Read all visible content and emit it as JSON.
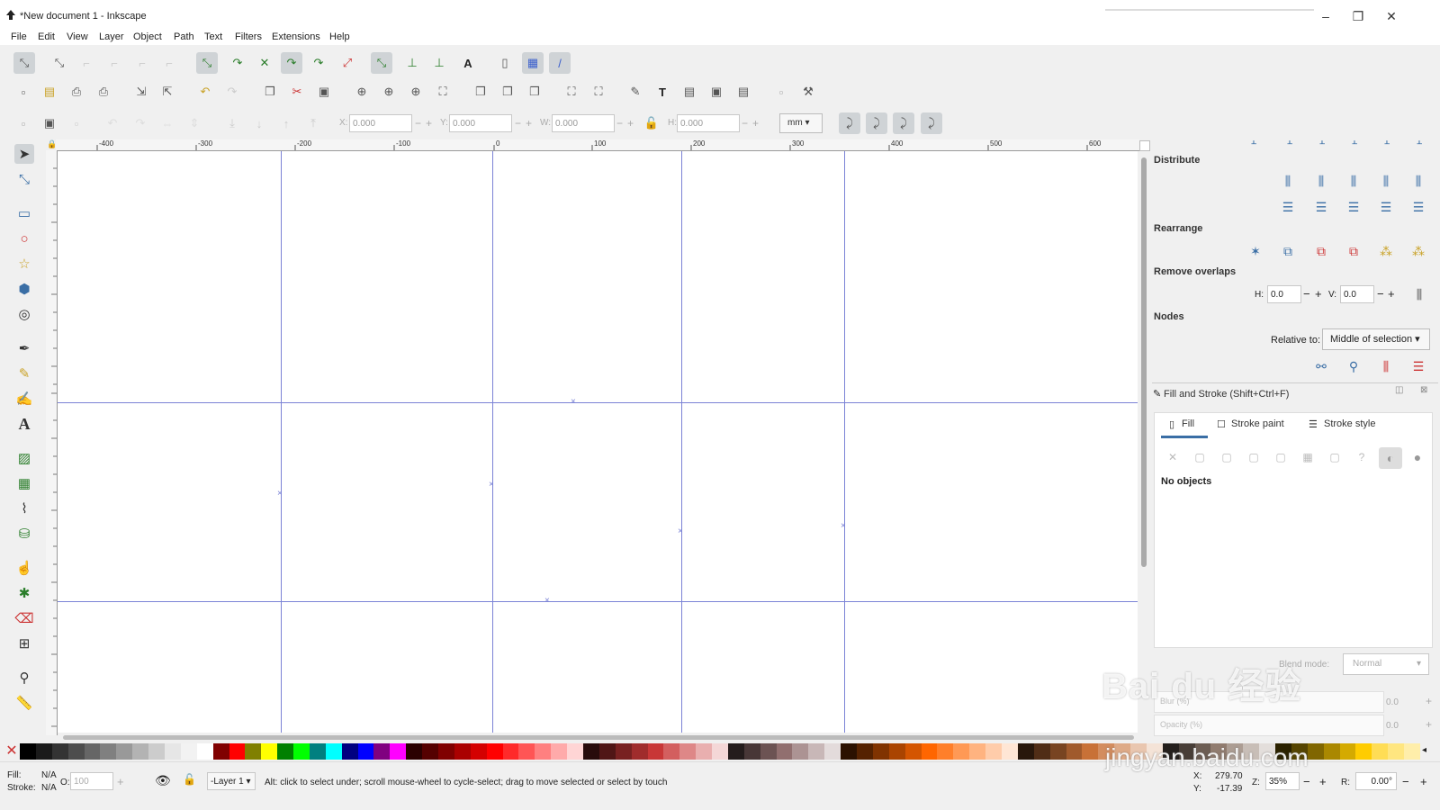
{
  "window": {
    "title": "*New document 1 - Inkscape",
    "minimize": "–",
    "maximize": "❐",
    "close": "✕"
  },
  "menu": [
    "File",
    "Edit",
    "View",
    "Layer",
    "Object",
    "Path",
    "Text",
    "Filters",
    "Extensions",
    "Help"
  ],
  "toolbar_select": {
    "x_label": "X:",
    "x_value": "0.000",
    "y_label": "Y:",
    "y_value": "0.000",
    "w_label": "W:",
    "w_value": "0.000",
    "h_label": "H:",
    "h_value": "0.000",
    "unit": "mm",
    "minus": "−",
    "plus": "+"
  },
  "ruler_top": [
    "-400",
    "-300",
    "-200",
    "-100",
    "0",
    "100",
    "200",
    "300",
    "400",
    "500",
    "600"
  ],
  "panel": {
    "distribute": "Distribute",
    "rearrange": "Rearrange",
    "remove_overlaps": "Remove overlaps",
    "h_label": "H:",
    "h_value": "0.0",
    "v_label": "V:",
    "v_value": "0.0",
    "nodes": "Nodes",
    "relative_to_label": "Relative to:",
    "relative_to_value": "Middle of selection"
  },
  "fill_stroke": {
    "title": "Fill and Stroke (Shift+Ctrl+F)",
    "tab_fill": "Fill",
    "tab_stroke_paint": "Stroke paint",
    "tab_stroke_style": "Stroke style",
    "no_objects": "No objects",
    "blend_label": "Blend mode:",
    "blend_value": "Normal",
    "blur_label": "Blur (%)",
    "blur_value": "0.0",
    "opacity_label": "Opacity (%)",
    "opacity_value": "0.0"
  },
  "status": {
    "fill_label": "Fill:",
    "fill_value": "N/A",
    "stroke_label": "Stroke:",
    "stroke_value": "N/A",
    "opacity_label": "O:",
    "opacity_value": "100",
    "layer": "-Layer 1",
    "message": "Alt: click to select under; scroll mouse-wheel to cycle-select; drag to move selected or select by touch",
    "x_label": "X:",
    "x_value": "279.70",
    "y_label": "Y:",
    "y_value": "-17.39",
    "zoom_label": "Z:",
    "zoom_value": "35%",
    "rot_label": "R:",
    "rot_value": "0.00°"
  },
  "palette": [
    "#000000",
    "#1a1a1a",
    "#333333",
    "#4d4d4d",
    "#666666",
    "#808080",
    "#999999",
    "#b3b3b3",
    "#cccccc",
    "#e6e6e6",
    "#f2f2f2",
    "#ffffff",
    "#800000",
    "#ff0000",
    "#808000",
    "#ffff00",
    "#008000",
    "#00ff00",
    "#008080",
    "#00ffff",
    "#000080",
    "#0000ff",
    "#800080",
    "#ff00ff",
    "#2b0000",
    "#550000",
    "#800000",
    "#aa0000",
    "#d40000",
    "#ff0000",
    "#ff2a2a",
    "#ff5555",
    "#ff8080",
    "#ffaaaa",
    "#ffd5d5",
    "#280b0b",
    "#501616",
    "#782121",
    "#a02c2c",
    "#c83737",
    "#d35f5f",
    "#de8787",
    "#e9afaf",
    "#f4d7d7",
    "#241c1c",
    "#483737",
    "#6c5353",
    "#916f6f",
    "#ac9393",
    "#c8b7b7",
    "#e3dbdb",
    "#2b1100",
    "#552200",
    "#803300",
    "#aa4400",
    "#d45500",
    "#ff6600",
    "#ff7f2a",
    "#ff9955",
    "#ffb380",
    "#ffccaa",
    "#ffe6d5",
    "#28170b",
    "#502d16",
    "#784421",
    "#a05a2c",
    "#c87137",
    "#d38d5f",
    "#deaa87",
    "#e9c6af",
    "#f4e3d7",
    "#241f1c",
    "#483e37",
    "#6c5d53",
    "#917c6f",
    "#ac9d93",
    "#c8beb7",
    "#e3dedb",
    "#2b2200",
    "#554400",
    "#806600",
    "#aa8800",
    "#d4aa00",
    "#ffcc00",
    "#ffdd55",
    "#ffe680",
    "#ffeeaa"
  ],
  "watermark": {
    "logo": "Bai du 经验",
    "url": "jingyan.baidu.com"
  }
}
